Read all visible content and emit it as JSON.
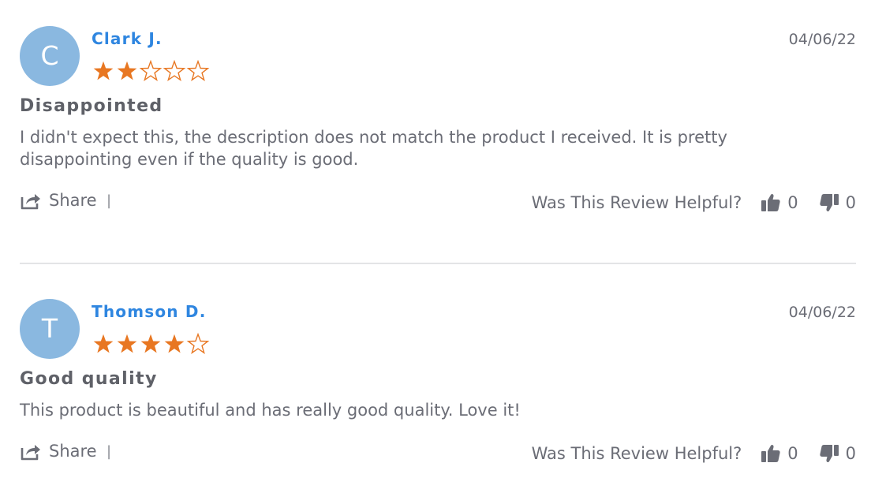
{
  "colors": {
    "accent": "#2f86e0",
    "avatar_bg": "#8ab8e0",
    "star": "#e87722",
    "text": "#6b6d76",
    "divider": "#e3e4e6"
  },
  "reviews": [
    {
      "avatar_initial": "C",
      "author": "Clark J.",
      "date": "04/06/22",
      "rating": 2,
      "max_rating": 5,
      "title": "Disappointed",
      "body": "I didn't expect this, the description does not match the product I received. It is pretty disappointing even if the quality is good.",
      "share_label": "Share",
      "separator": "|",
      "helpful_question": "Was This Review Helpful?",
      "upvotes": "0",
      "downvotes": "0"
    },
    {
      "avatar_initial": "T",
      "author": "Thomson D.",
      "date": "04/06/22",
      "rating": 4,
      "max_rating": 5,
      "title": "Good quality",
      "body": "This product is beautiful and has really good quality. Love it!",
      "share_label": "Share",
      "separator": "|",
      "helpful_question": "Was This Review Helpful?",
      "upvotes": "0",
      "downvotes": "0"
    }
  ],
  "icons": {
    "share": "share-icon",
    "thumbs_up": "thumbs-up-icon",
    "thumbs_down": "thumbs-down-icon",
    "star_filled": "star-filled-icon",
    "star_empty": "star-empty-icon"
  }
}
